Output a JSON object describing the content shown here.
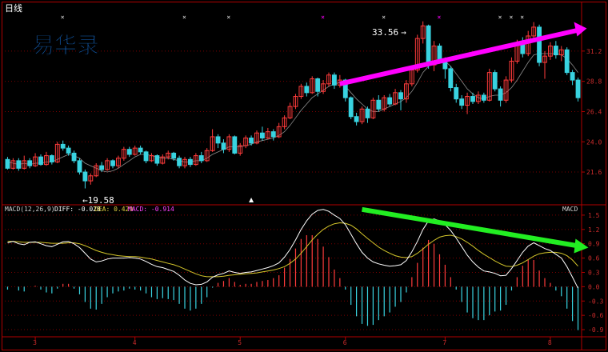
{
  "header": {
    "title": "日线",
    "markers": [
      "×",
      "×",
      "×",
      "×",
      "×",
      "×",
      "×",
      "×",
      "×"
    ]
  },
  "logo": {
    "text": "易华录",
    "color": "#1565c0"
  },
  "colors": {
    "up": "#ff3b3b",
    "down": "#39d3e0",
    "ma": "#ffffff",
    "frame": "#b00000",
    "arrow_up": "#ff00ff",
    "arrow_down": "#22ee22",
    "diff": "#ffffff",
    "dea": "#d4c62a",
    "macd_label": "#ff40ff",
    "diff_label": "#ffffff",
    "dea_label": "#e0d040"
  },
  "chart_data": [
    {
      "type": "candlestick",
      "title": "日线",
      "y_ticks": [
        "31.2",
        "28.8",
        "26.4",
        "24.0",
        "21.6"
      ],
      "ylim": [
        19.0,
        35.0
      ],
      "annotations": {
        "high_label": "33.56",
        "low_label": "19.58"
      },
      "candles": [
        {
          "o": 22.6,
          "c": 21.9,
          "h": 22.8,
          "l": 21.8
        },
        {
          "o": 21.9,
          "c": 22.5,
          "h": 22.7,
          "l": 21.8
        },
        {
          "o": 22.5,
          "c": 21.9,
          "h": 22.7,
          "l": 21.7
        },
        {
          "o": 21.9,
          "c": 22.5,
          "h": 22.9,
          "l": 21.8
        },
        {
          "o": 22.5,
          "c": 22.1,
          "h": 22.7,
          "l": 21.9
        },
        {
          "o": 22.1,
          "c": 22.8,
          "h": 23.1,
          "l": 22.0
        },
        {
          "o": 22.8,
          "c": 22.2,
          "h": 23.0,
          "l": 22.1
        },
        {
          "o": 22.2,
          "c": 22.9,
          "h": 23.2,
          "l": 22.1
        },
        {
          "o": 22.9,
          "c": 22.4,
          "h": 23.0,
          "l": 22.2
        },
        {
          "o": 22.4,
          "c": 23.8,
          "h": 24.0,
          "l": 22.3
        },
        {
          "o": 23.8,
          "c": 23.5,
          "h": 24.1,
          "l": 23.3
        },
        {
          "o": 23.5,
          "c": 23.1,
          "h": 23.7,
          "l": 22.9
        },
        {
          "o": 23.1,
          "c": 22.5,
          "h": 23.3,
          "l": 22.3
        },
        {
          "o": 22.5,
          "c": 21.6,
          "h": 22.7,
          "l": 21.4
        },
        {
          "o": 21.6,
          "c": 20.9,
          "h": 21.8,
          "l": 20.3
        },
        {
          "o": 20.9,
          "c": 21.3,
          "h": 21.5,
          "l": 20.6
        },
        {
          "o": 21.3,
          "c": 22.1,
          "h": 22.3,
          "l": 21.2
        },
        {
          "o": 22.1,
          "c": 21.8,
          "h": 22.4,
          "l": 21.6
        },
        {
          "o": 21.8,
          "c": 22.5,
          "h": 22.7,
          "l": 21.7
        },
        {
          "o": 22.5,
          "c": 22.1,
          "h": 22.6,
          "l": 21.9
        },
        {
          "o": 22.1,
          "c": 22.7,
          "h": 22.9,
          "l": 21.9
        },
        {
          "o": 22.7,
          "c": 23.4,
          "h": 23.6,
          "l": 22.5
        },
        {
          "o": 23.4,
          "c": 23.0,
          "h": 23.6,
          "l": 22.8
        },
        {
          "o": 23.0,
          "c": 23.5,
          "h": 23.7,
          "l": 22.9
        },
        {
          "o": 23.5,
          "c": 23.2,
          "h": 23.7,
          "l": 23.0
        },
        {
          "o": 23.2,
          "c": 22.5,
          "h": 23.3,
          "l": 22.3
        },
        {
          "o": 22.5,
          "c": 22.9,
          "h": 23.1,
          "l": 22.4
        },
        {
          "o": 22.9,
          "c": 22.3,
          "h": 23.0,
          "l": 22.1
        },
        {
          "o": 22.3,
          "c": 22.8,
          "h": 23.0,
          "l": 22.2
        },
        {
          "o": 22.8,
          "c": 23.1,
          "h": 23.3,
          "l": 22.6
        },
        {
          "o": 23.1,
          "c": 22.7,
          "h": 23.2,
          "l": 22.5
        },
        {
          "o": 22.7,
          "c": 22.1,
          "h": 22.9,
          "l": 21.9
        },
        {
          "o": 22.1,
          "c": 22.6,
          "h": 22.8,
          "l": 21.9
        },
        {
          "o": 22.6,
          "c": 22.2,
          "h": 22.8,
          "l": 22.0
        },
        {
          "o": 22.2,
          "c": 22.9,
          "h": 23.1,
          "l": 22.1
        },
        {
          "o": 22.9,
          "c": 22.5,
          "h": 23.2,
          "l": 22.3
        },
        {
          "o": 22.5,
          "c": 23.3,
          "h": 23.5,
          "l": 22.4
        },
        {
          "o": 23.3,
          "c": 24.4,
          "h": 25.0,
          "l": 23.2
        },
        {
          "o": 24.4,
          "c": 23.9,
          "h": 24.6,
          "l": 23.5
        },
        {
          "o": 23.9,
          "c": 23.4,
          "h": 24.2,
          "l": 23.1
        },
        {
          "o": 23.4,
          "c": 24.4,
          "h": 24.6,
          "l": 23.2
        },
        {
          "o": 24.4,
          "c": 23.1,
          "h": 24.5,
          "l": 23.0
        },
        {
          "o": 23.1,
          "c": 23.7,
          "h": 23.9,
          "l": 22.9
        },
        {
          "o": 23.7,
          "c": 24.3,
          "h": 24.5,
          "l": 23.5
        },
        {
          "o": 24.3,
          "c": 23.9,
          "h": 24.5,
          "l": 23.7
        },
        {
          "o": 23.9,
          "c": 24.7,
          "h": 24.9,
          "l": 23.8
        },
        {
          "o": 24.7,
          "c": 24.3,
          "h": 25.2,
          "l": 24.1
        },
        {
          "o": 24.3,
          "c": 24.8,
          "h": 25.1,
          "l": 24.2
        },
        {
          "o": 24.8,
          "c": 24.4,
          "h": 25.0,
          "l": 24.1
        },
        {
          "o": 24.4,
          "c": 25.2,
          "h": 25.5,
          "l": 24.3
        },
        {
          "o": 25.2,
          "c": 25.9,
          "h": 26.1,
          "l": 25.0
        },
        {
          "o": 25.9,
          "c": 26.8,
          "h": 27.1,
          "l": 25.8
        },
        {
          "o": 26.8,
          "c": 27.6,
          "h": 27.8,
          "l": 26.6
        },
        {
          "o": 27.6,
          "c": 28.4,
          "h": 28.6,
          "l": 27.4
        },
        {
          "o": 28.4,
          "c": 27.9,
          "h": 28.7,
          "l": 27.6
        },
        {
          "o": 27.9,
          "c": 29.0,
          "h": 29.2,
          "l": 27.8
        },
        {
          "o": 29.0,
          "c": 28.0,
          "h": 29.1,
          "l": 27.6
        },
        {
          "o": 28.0,
          "c": 28.6,
          "h": 28.9,
          "l": 27.8
        },
        {
          "o": 28.6,
          "c": 29.3,
          "h": 29.5,
          "l": 28.4
        },
        {
          "o": 29.3,
          "c": 28.5,
          "h": 29.5,
          "l": 28.2
        },
        {
          "o": 28.5,
          "c": 28.9,
          "h": 29.3,
          "l": 28.3
        },
        {
          "o": 28.9,
          "c": 27.5,
          "h": 29.0,
          "l": 27.2
        },
        {
          "o": 27.5,
          "c": 26.0,
          "h": 27.6,
          "l": 25.8
        },
        {
          "o": 26.0,
          "c": 25.6,
          "h": 26.3,
          "l": 25.3
        },
        {
          "o": 25.6,
          "c": 26.6,
          "h": 26.8,
          "l": 25.4
        },
        {
          "o": 26.6,
          "c": 25.9,
          "h": 26.8,
          "l": 25.5
        },
        {
          "o": 25.9,
          "c": 27.3,
          "h": 27.5,
          "l": 25.8
        },
        {
          "o": 27.3,
          "c": 26.6,
          "h": 27.7,
          "l": 26.4
        },
        {
          "o": 26.6,
          "c": 27.5,
          "h": 27.7,
          "l": 26.4
        },
        {
          "o": 27.5,
          "c": 27.0,
          "h": 27.8,
          "l": 26.8
        },
        {
          "o": 27.0,
          "c": 27.9,
          "h": 28.2,
          "l": 26.9
        },
        {
          "o": 27.9,
          "c": 27.4,
          "h": 28.1,
          "l": 26.5
        },
        {
          "o": 27.4,
          "c": 28.6,
          "h": 28.9,
          "l": 27.1
        },
        {
          "o": 28.6,
          "c": 29.7,
          "h": 29.9,
          "l": 28.4
        },
        {
          "o": 29.7,
          "c": 32.2,
          "h": 32.5,
          "l": 29.5
        },
        {
          "o": 32.2,
          "c": 33.2,
          "h": 33.56,
          "l": 31.8
        },
        {
          "o": 33.2,
          "c": 30.1,
          "h": 33.3,
          "l": 29.8
        },
        {
          "o": 30.1,
          "c": 31.6,
          "h": 32.0,
          "l": 29.6
        },
        {
          "o": 31.6,
          "c": 30.5,
          "h": 31.8,
          "l": 30.2
        },
        {
          "o": 30.5,
          "c": 29.8,
          "h": 30.7,
          "l": 29.0
        },
        {
          "o": 29.8,
          "c": 28.3,
          "h": 30.0,
          "l": 28.0
        },
        {
          "o": 28.3,
          "c": 27.4,
          "h": 28.6,
          "l": 27.1
        },
        {
          "o": 27.4,
          "c": 26.9,
          "h": 27.7,
          "l": 26.6
        },
        {
          "o": 26.9,
          "c": 27.6,
          "h": 27.9,
          "l": 26.2
        },
        {
          "o": 27.6,
          "c": 27.2,
          "h": 27.9,
          "l": 27.0
        },
        {
          "o": 27.2,
          "c": 27.7,
          "h": 28.0,
          "l": 27.0
        },
        {
          "o": 27.7,
          "c": 27.3,
          "h": 27.9,
          "l": 27.1
        },
        {
          "o": 27.3,
          "c": 29.5,
          "h": 29.8,
          "l": 27.2
        },
        {
          "o": 29.5,
          "c": 28.2,
          "h": 29.7,
          "l": 28.0
        },
        {
          "o": 28.2,
          "c": 27.3,
          "h": 28.4,
          "l": 26.8
        },
        {
          "o": 27.3,
          "c": 28.9,
          "h": 29.2,
          "l": 27.1
        },
        {
          "o": 28.9,
          "c": 30.4,
          "h": 30.7,
          "l": 28.7
        },
        {
          "o": 30.4,
          "c": 31.8,
          "h": 32.1,
          "l": 30.2
        },
        {
          "o": 31.8,
          "c": 31.0,
          "h": 32.3,
          "l": 30.7
        },
        {
          "o": 31.0,
          "c": 32.4,
          "h": 32.8,
          "l": 30.8
        },
        {
          "o": 32.4,
          "c": 33.1,
          "h": 33.5,
          "l": 32.1
        },
        {
          "o": 33.1,
          "c": 30.3,
          "h": 33.3,
          "l": 30.0
        },
        {
          "o": 30.3,
          "c": 30.8,
          "h": 31.2,
          "l": 29.0
        },
        {
          "o": 30.8,
          "c": 31.6,
          "h": 31.9,
          "l": 30.5
        },
        {
          "o": 31.6,
          "c": 30.9,
          "h": 32.0,
          "l": 30.6
        },
        {
          "o": 30.9,
          "c": 31.3,
          "h": 31.6,
          "l": 30.4
        },
        {
          "o": 31.3,
          "c": 29.5,
          "h": 31.5,
          "l": 29.3
        },
        {
          "o": 29.5,
          "c": 28.9,
          "h": 29.7,
          "l": 28.5
        },
        {
          "o": 28.9,
          "c": 27.5,
          "h": 29.1,
          "l": 27.2
        }
      ],
      "ma": [
        22.4,
        22.3,
        22.2,
        22.3,
        22.2,
        22.3,
        22.3,
        22.4,
        22.4,
        22.6,
        22.8,
        23.0,
        22.9,
        22.7,
        22.3,
        22.1,
        21.9,
        21.7,
        21.6,
        21.7,
        21.9,
        22.2,
        22.5,
        22.8,
        23.0,
        23.0,
        22.9,
        22.8,
        22.7,
        22.7,
        22.6,
        22.5,
        22.4,
        22.4,
        22.5,
        22.5,
        22.7,
        23.0,
        23.2,
        23.4,
        23.6,
        23.6,
        23.6,
        23.7,
        23.8,
        24.0,
        24.1,
        24.2,
        24.3,
        24.5,
        24.8,
        25.3,
        25.9,
        26.5,
        27.0,
        27.5,
        27.8,
        28.1,
        28.4,
        28.6,
        28.7,
        28.4,
        27.9,
        27.4,
        27.0,
        26.6,
        26.4,
        26.4,
        26.6,
        26.8,
        27.0,
        27.2,
        27.5,
        28.0,
        28.7,
        29.5,
        30.0,
        30.4,
        30.6,
        30.4,
        30.0,
        29.4,
        28.8,
        28.2,
        27.8,
        27.5,
        27.4,
        27.6,
        27.7,
        27.7,
        27.9,
        28.3,
        28.9,
        29.6,
        30.3,
        30.9,
        31.0,
        31.0,
        31.0,
        31.0,
        30.9,
        30.6,
        30.1,
        29.5
      ]
    },
    {
      "type": "macd",
      "title": "MACD",
      "params": "MACD(12,26,9)",
      "diff_label": "DIFF: -0.028",
      "dea_label": "DEA: 0.429",
      "macd_label": "MACD: -0.914",
      "y_ticks": [
        "1.5",
        "1.2",
        "0.9",
        "0.6",
        "0.3",
        "0.0",
        "-0.3",
        "-0.6",
        "-0.9"
      ],
      "ylim": [
        -1.05,
        1.7
      ],
      "x_labels": [
        "3",
        "4",
        "5",
        "6",
        "7",
        "8"
      ],
      "x_label_index": [
        5,
        23,
        42,
        61,
        79,
        98
      ],
      "diff": [
        0.92,
        0.95,
        0.9,
        0.88,
        0.93,
        0.94,
        0.9,
        0.86,
        0.84,
        0.89,
        0.94,
        0.95,
        0.9,
        0.82,
        0.7,
        0.58,
        0.52,
        0.54,
        0.58,
        0.6,
        0.6,
        0.6,
        0.61,
        0.6,
        0.58,
        0.53,
        0.47,
        0.42,
        0.4,
        0.36,
        0.32,
        0.24,
        0.14,
        0.07,
        0.04,
        0.05,
        0.1,
        0.2,
        0.25,
        0.28,
        0.33,
        0.3,
        0.28,
        0.3,
        0.31,
        0.34,
        0.37,
        0.4,
        0.44,
        0.5,
        0.62,
        0.78,
        0.98,
        1.2,
        1.38,
        1.52,
        1.6,
        1.62,
        1.58,
        1.5,
        1.43,
        1.3,
        1.1,
        0.9,
        0.72,
        0.6,
        0.52,
        0.48,
        0.45,
        0.43,
        0.44,
        0.46,
        0.55,
        0.73,
        0.95,
        1.2,
        1.38,
        1.42,
        1.38,
        1.3,
        1.18,
        1.02,
        0.84,
        0.66,
        0.52,
        0.41,
        0.33,
        0.31,
        0.28,
        0.23,
        0.24,
        0.38,
        0.55,
        0.72,
        0.85,
        0.92,
        0.86,
        0.8,
        0.76,
        0.68,
        0.6,
        0.42,
        0.2,
        -0.03
      ],
      "dea": [
        0.95,
        0.95,
        0.94,
        0.93,
        0.93,
        0.93,
        0.93,
        0.92,
        0.91,
        0.91,
        0.91,
        0.92,
        0.92,
        0.9,
        0.86,
        0.81,
        0.76,
        0.72,
        0.69,
        0.67,
        0.65,
        0.64,
        0.63,
        0.63,
        0.62,
        0.6,
        0.58,
        0.55,
        0.52,
        0.49,
        0.46,
        0.42,
        0.37,
        0.32,
        0.27,
        0.23,
        0.21,
        0.21,
        0.21,
        0.22,
        0.24,
        0.25,
        0.26,
        0.27,
        0.28,
        0.29,
        0.31,
        0.33,
        0.35,
        0.38,
        0.42,
        0.49,
        0.58,
        0.7,
        0.84,
        0.98,
        1.1,
        1.2,
        1.27,
        1.32,
        1.34,
        1.33,
        1.29,
        1.21,
        1.11,
        1.01,
        0.92,
        0.83,
        0.76,
        0.7,
        0.65,
        0.62,
        0.61,
        0.63,
        0.7,
        0.79,
        0.89,
        0.97,
        1.04,
        1.07,
        1.08,
        1.05,
        1.0,
        0.93,
        0.85,
        0.76,
        0.68,
        0.61,
        0.54,
        0.48,
        0.43,
        0.42,
        0.45,
        0.5,
        0.57,
        0.64,
        0.69,
        0.71,
        0.72,
        0.72,
        0.7,
        0.65,
        0.56,
        0.43
      ],
      "macd": [
        -0.06,
        0.0,
        -0.08,
        -0.1,
        0.0,
        0.02,
        -0.06,
        -0.12,
        -0.14,
        -0.04,
        0.06,
        0.06,
        -0.04,
        -0.16,
        -0.32,
        -0.46,
        -0.48,
        -0.36,
        -0.22,
        -0.14,
        -0.1,
        -0.08,
        -0.04,
        -0.06,
        -0.08,
        -0.14,
        -0.22,
        -0.26,
        -0.24,
        -0.26,
        -0.28,
        -0.36,
        -0.46,
        -0.5,
        -0.46,
        -0.36,
        -0.22,
        -0.02,
        0.08,
        0.12,
        0.18,
        0.1,
        0.04,
        0.06,
        0.06,
        0.1,
        0.12,
        0.14,
        0.18,
        0.24,
        0.4,
        0.58,
        0.8,
        1.0,
        1.08,
        1.08,
        1.0,
        0.84,
        0.62,
        0.36,
        0.18,
        -0.06,
        -0.38,
        -0.62,
        -0.78,
        -0.82,
        -0.8,
        -0.7,
        -0.62,
        -0.54,
        -0.42,
        -0.32,
        -0.12,
        0.2,
        0.5,
        0.82,
        0.98,
        0.9,
        0.68,
        0.46,
        0.2,
        -0.06,
        -0.32,
        -0.54,
        -0.66,
        -0.7,
        -0.7,
        -0.6,
        -0.52,
        -0.5,
        -0.38,
        -0.08,
        0.2,
        0.44,
        0.56,
        0.56,
        0.34,
        0.18,
        0.08,
        -0.08,
        -0.2,
        -0.46,
        -0.72,
        -0.91
      ]
    }
  ]
}
